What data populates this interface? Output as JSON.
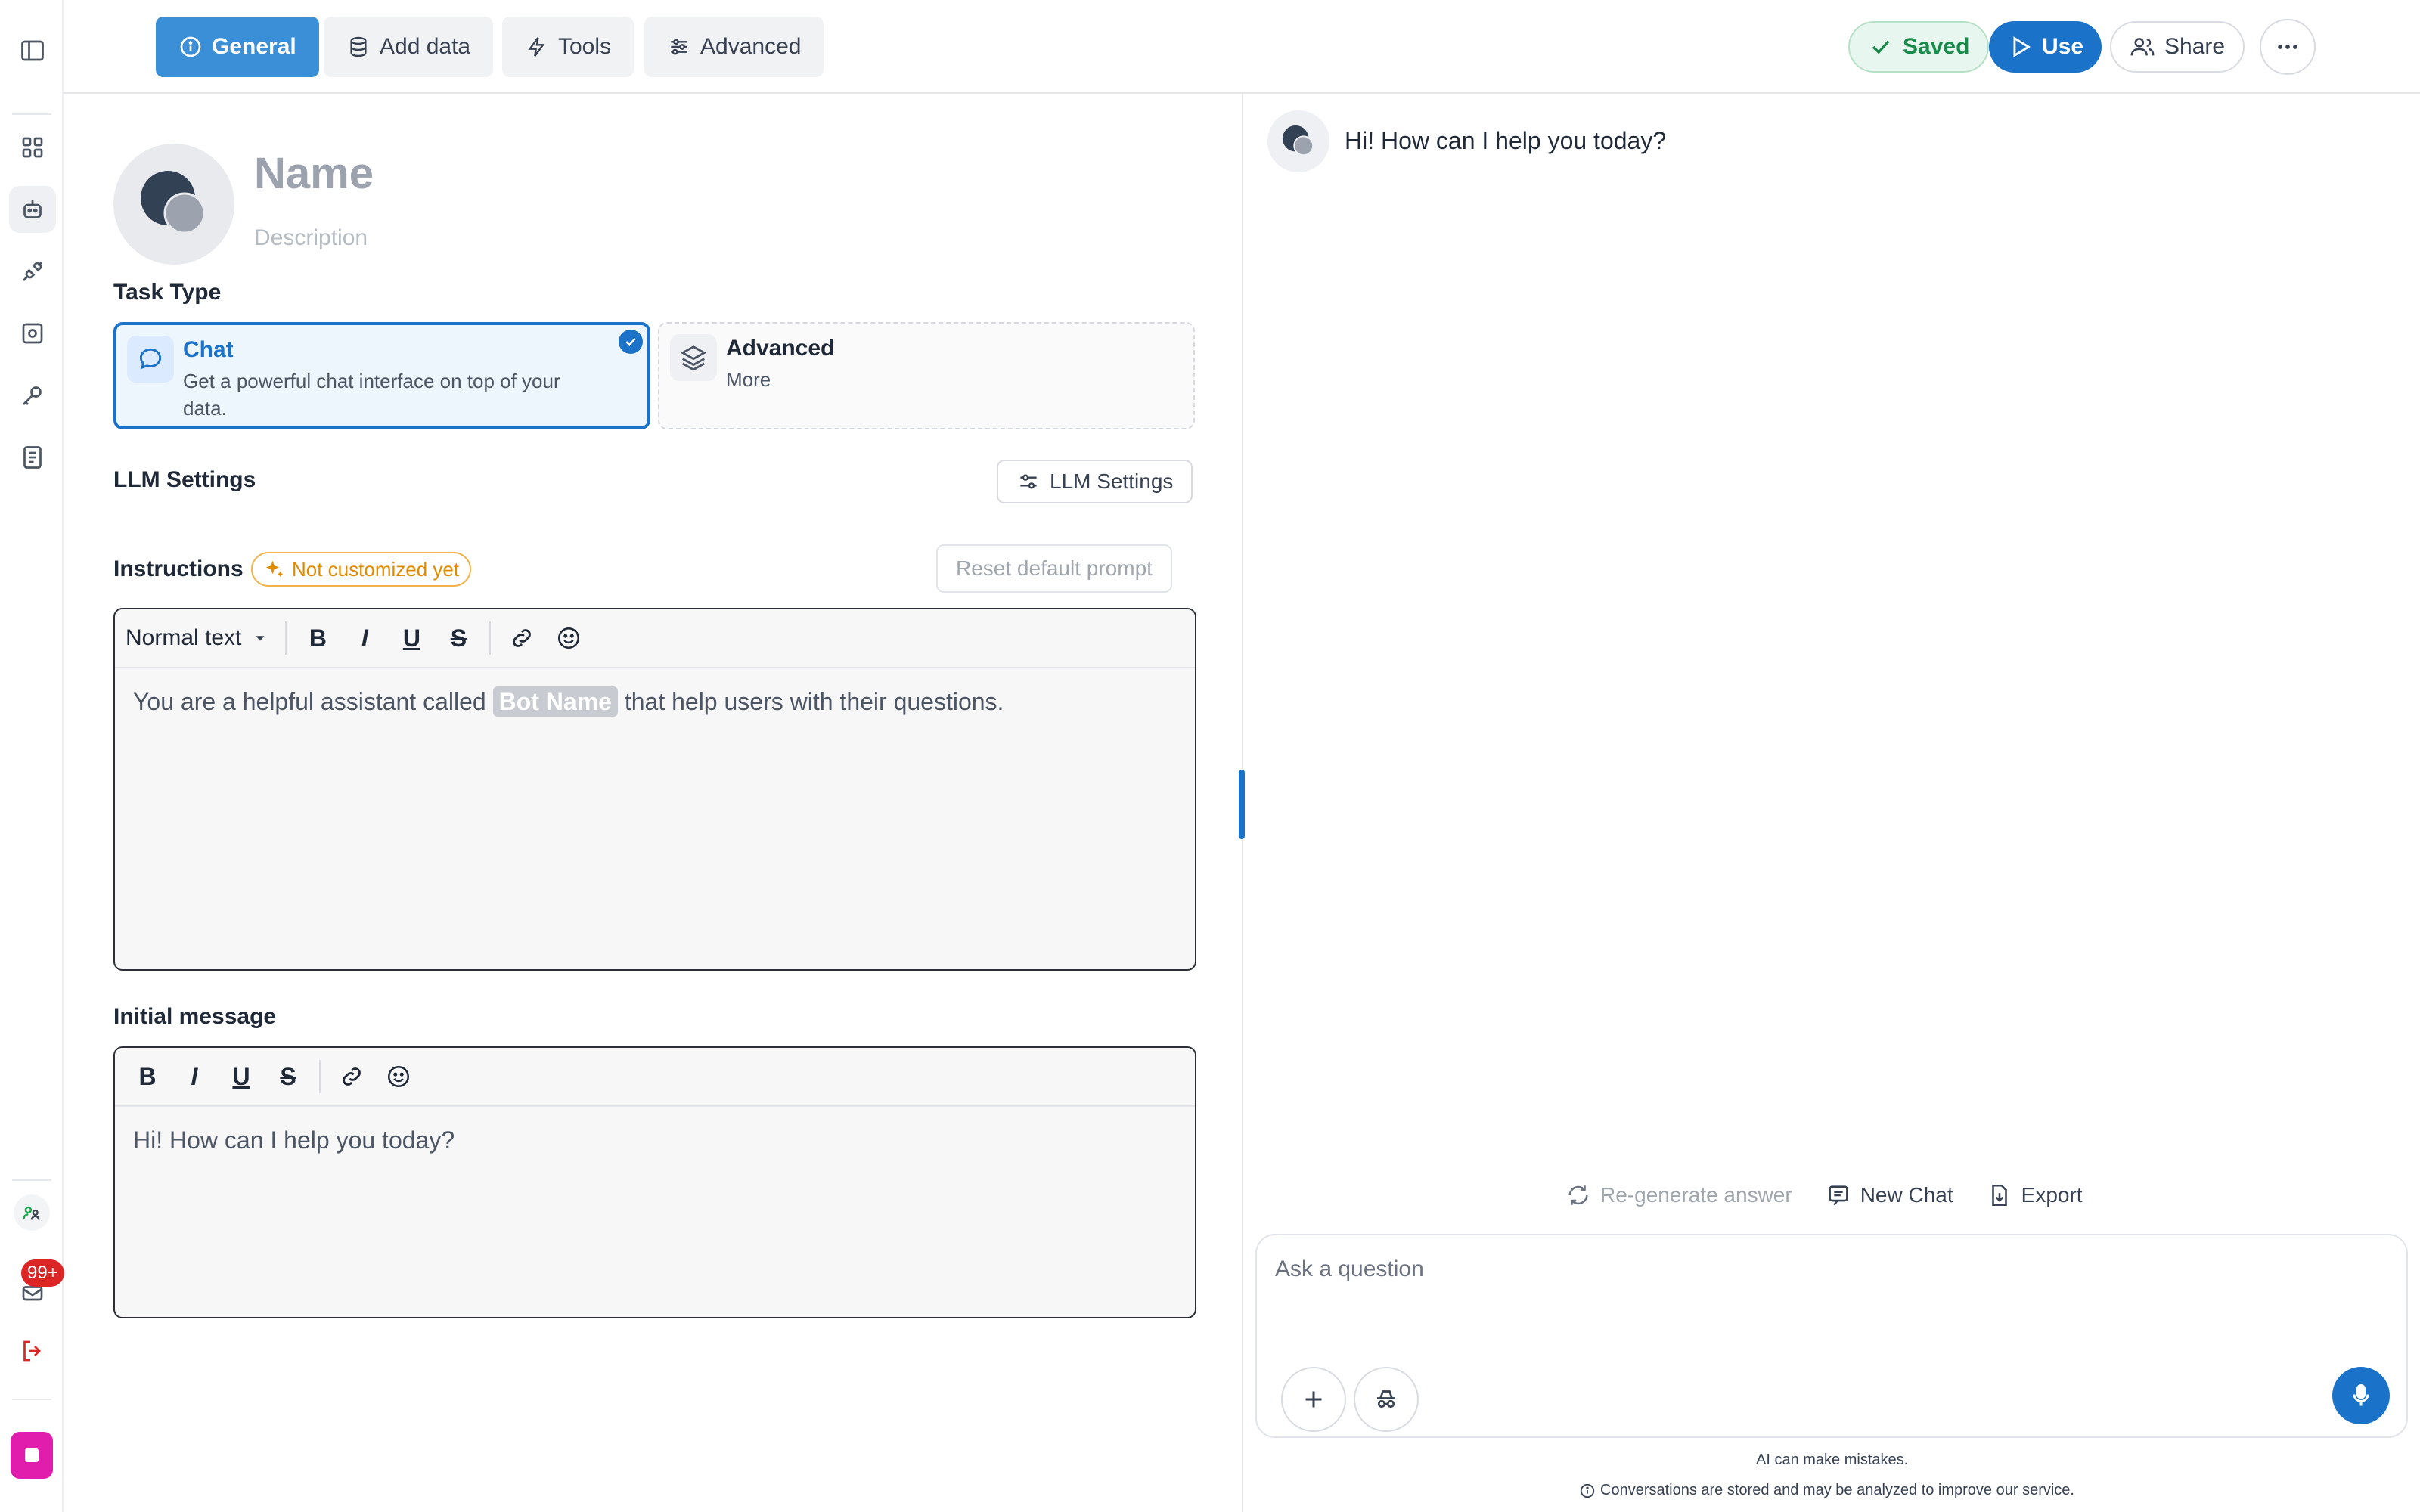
{
  "colors": {
    "accent": "#1a73c9",
    "tab_active": "#3b8fd6",
    "saved_green": "#1a8a4a",
    "warn_orange": "#e08a00",
    "badge_red": "#dc2626",
    "app_magenta": "#e11dae"
  },
  "rail": {
    "icons": [
      "sidebar-toggle-icon",
      "dashboard-icon",
      "bot-icon",
      "plug-icon",
      "scan-icon",
      "key-icon",
      "document-icon",
      "team-avatar-icon",
      "mail-icon",
      "logout-icon",
      "app-logo-icon"
    ],
    "notification_badge": "99+"
  },
  "topbar": {
    "tabs": [
      {
        "label": "General",
        "icon": "info-icon",
        "active": true
      },
      {
        "label": "Add data",
        "icon": "database-icon",
        "active": false
      },
      {
        "label": "Tools",
        "icon": "bolt-icon",
        "active": false
      },
      {
        "label": "Advanced",
        "icon": "sliders-icon",
        "active": false
      }
    ],
    "saved_label": "Saved",
    "use_label": "Use",
    "share_label": "Share"
  },
  "bot": {
    "name_placeholder": "Name",
    "description_placeholder": "Description"
  },
  "task_type": {
    "heading": "Task Type",
    "options": [
      {
        "title": "Chat",
        "description": "Get a powerful chat interface on top of your data.",
        "selected": true
      },
      {
        "title": "Advanced",
        "description": "More",
        "selected": false
      }
    ]
  },
  "llm": {
    "heading": "LLM Settings",
    "button_label": "LLM Settings"
  },
  "instructions": {
    "heading": "Instructions",
    "badge": "Not customized yet",
    "reset_label": "Reset default prompt",
    "format_select": "Normal text",
    "text_before": "You are a helpful assistant called ",
    "variable": "Bot Name",
    "text_after": " that help users with their questions."
  },
  "initial_message": {
    "heading": "Initial message",
    "text": "Hi! How can I help you today?"
  },
  "chat": {
    "greeting": "Hi! How can I help you today?",
    "regenerate_label": "Re-generate answer",
    "new_chat_label": "New Chat",
    "export_label": "Export",
    "input_placeholder": "Ask a question",
    "disclaimer": "AI can make mistakes.",
    "privacy_note": "Conversations are stored and may be analyzed to improve our service."
  }
}
